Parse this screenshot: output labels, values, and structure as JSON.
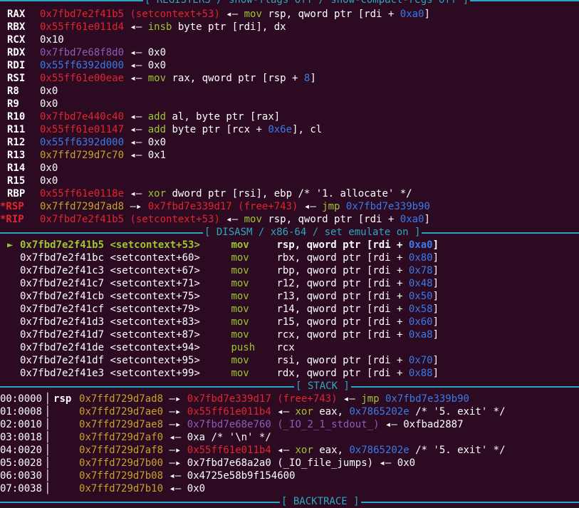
{
  "sections": {
    "registers": "[ REGISTERS / show-flags off / show-compact-regs off ]",
    "disasm": "[ DISASM / x86-64 / set emulate on ]",
    "stack": "[ STACK ]",
    "backtrace": "[ BACKTRACE ]"
  },
  "arrow": "◂—",
  "pointer": "—▸",
  "current": "►",
  "registers": [
    {
      "name": "RAX",
      "val": "0x7fbd7e2f41b5",
      "sym": " (setcontext+53)",
      "rest": [
        [
          "mov",
          "y"
        ],
        [
          " rsp, qword ptr [rdi + ",
          "w"
        ],
        [
          "0xa0",
          "b"
        ],
        [
          "]",
          "w"
        ]
      ]
    },
    {
      "name": "RBX",
      "val": "0x55ff61e011d4",
      "sym": "",
      "rest": [
        [
          "insb",
          "y"
        ],
        [
          " byte ptr [rdi], dx",
          "w"
        ]
      ]
    },
    {
      "name": "RCX",
      "val": "0x10",
      "plain": true
    },
    {
      "name": "RDX",
      "val": "0x7fbd7e68f8d0",
      "sym": "",
      "rest": [
        [
          "0x0",
          "w"
        ]
      ],
      "color": "p"
    },
    {
      "name": "RDI",
      "val": "0x55ff6392d000",
      "sym": "",
      "rest": [
        [
          "0x0",
          "w"
        ]
      ],
      "color": "b"
    },
    {
      "name": "RSI",
      "val": "0x55ff61e00eae",
      "sym": "",
      "rest": [
        [
          "mov",
          "y"
        ],
        [
          " rax, qword ptr [rsp + ",
          "w"
        ],
        [
          "8",
          "b"
        ],
        [
          "]",
          "w"
        ]
      ]
    },
    {
      "name": "R8",
      "val": "0x0",
      "plain": true
    },
    {
      "name": "R9",
      "val": "0x0",
      "plain": true
    },
    {
      "name": "R10",
      "val": "0x7fbd7e440c40",
      "sym": "",
      "rest": [
        [
          "add",
          "y"
        ],
        [
          " al, byte ptr [rax]",
          "w"
        ]
      ]
    },
    {
      "name": "R11",
      "val": "0x55ff61e01147",
      "sym": "",
      "rest": [
        [
          "add",
          "y"
        ],
        [
          " byte ptr [rcx + ",
          "w"
        ],
        [
          "0x6e",
          "b"
        ],
        [
          "], cl",
          "w"
        ]
      ]
    },
    {
      "name": "R12",
      "val": "0x55ff6392d000",
      "sym": "",
      "rest": [
        [
          "0x0",
          "w"
        ]
      ],
      "color": "b"
    },
    {
      "name": "R13",
      "val": "0x7ffd729d7c70",
      "sym": "",
      "rest": [
        [
          "0x1",
          "w"
        ]
      ],
      "color": "ye"
    },
    {
      "name": "R14",
      "val": "0x0",
      "plain": true
    },
    {
      "name": "R15",
      "val": "0x0",
      "plain": true
    },
    {
      "name": "RBP",
      "val": "0x55ff61e0118e",
      "sym": "",
      "rest": [
        [
          "xor",
          "y"
        ],
        [
          " dword ptr [rsi], ebp /* '1. allocate' */",
          "w"
        ]
      ]
    },
    {
      "name": "*RSP",
      "val": "0x7ffd729d7ad8",
      "special": "rsp"
    },
    {
      "name": "*RIP",
      "val": "0x7fbd7e2f41b5",
      "sym": " (setcontext+53)",
      "rest": [
        [
          "mov",
          "y"
        ],
        [
          " rsp, qword ptr [rdi + ",
          "w"
        ],
        [
          "0xa0",
          "b"
        ],
        [
          "]",
          "w"
        ]
      ]
    }
  ],
  "rsp_line": {
    "val": "0x7ffd729d7ad8",
    "target": "0x7fbd7e339d17",
    "sym": " (free+743)",
    "op": "jmp",
    "dest": "0x7fbd7e339b90"
  },
  "disasm": [
    {
      "addr": "0x7fbd7e2f41b5",
      "sym": "<setcontext+53>",
      "mnem": "mov",
      "ops": [
        [
          "rsp, qword ptr [rdi + ",
          "w"
        ],
        [
          "0xa0",
          "b"
        ],
        [
          "]",
          "w"
        ]
      ],
      "current": true
    },
    {
      "addr": "0x7fbd7e2f41bc",
      "sym": "<setcontext+60>",
      "mnem": "mov",
      "ops": [
        [
          "rbx, qword ptr [rdi + ",
          "w"
        ],
        [
          "0x80",
          "b"
        ],
        [
          "]",
          "w"
        ]
      ]
    },
    {
      "addr": "0x7fbd7e2f41c3",
      "sym": "<setcontext+67>",
      "mnem": "mov",
      "ops": [
        [
          "rbp, qword ptr [rdi + ",
          "w"
        ],
        [
          "0x78",
          "b"
        ],
        [
          "]",
          "w"
        ]
      ]
    },
    {
      "addr": "0x7fbd7e2f41c7",
      "sym": "<setcontext+71>",
      "mnem": "mov",
      "ops": [
        [
          "r12, qword ptr [rdi + ",
          "w"
        ],
        [
          "0x48",
          "b"
        ],
        [
          "]",
          "w"
        ]
      ]
    },
    {
      "addr": "0x7fbd7e2f41cb",
      "sym": "<setcontext+75>",
      "mnem": "mov",
      "ops": [
        [
          "r13, qword ptr [rdi + ",
          "w"
        ],
        [
          "0x50",
          "b"
        ],
        [
          "]",
          "w"
        ]
      ]
    },
    {
      "addr": "0x7fbd7e2f41cf",
      "sym": "<setcontext+79>",
      "mnem": "mov",
      "ops": [
        [
          "r14, qword ptr [rdi + ",
          "w"
        ],
        [
          "0x58",
          "b"
        ],
        [
          "]",
          "w"
        ]
      ]
    },
    {
      "addr": "0x7fbd7e2f41d3",
      "sym": "<setcontext+83>",
      "mnem": "mov",
      "ops": [
        [
          "r15, qword ptr [rdi + ",
          "w"
        ],
        [
          "0x60",
          "b"
        ],
        [
          "]",
          "w"
        ]
      ]
    },
    {
      "addr": "0x7fbd7e2f41d7",
      "sym": "<setcontext+87>",
      "mnem": "mov",
      "ops": [
        [
          "rcx, qword ptr [rdi + ",
          "w"
        ],
        [
          "0xa8",
          "b"
        ],
        [
          "]",
          "w"
        ]
      ]
    },
    {
      "addr": "0x7fbd7e2f41de",
      "sym": "<setcontext+94>",
      "mnem": "push",
      "ops": [
        [
          "rcx",
          "w"
        ]
      ]
    },
    {
      "addr": "0x7fbd7e2f41df",
      "sym": "<setcontext+95>",
      "mnem": "mov",
      "ops": [
        [
          "rsi, qword ptr [rdi + ",
          "w"
        ],
        [
          "0x70",
          "b"
        ],
        [
          "]",
          "w"
        ]
      ]
    },
    {
      "addr": "0x7fbd7e2f41e3",
      "sym": "<setcontext+99>",
      "mnem": "mov",
      "ops": [
        [
          "rdx, qword ptr [rdi + ",
          "w"
        ],
        [
          "0x88",
          "b"
        ],
        [
          "]",
          "w"
        ]
      ]
    }
  ],
  "stack": [
    {
      "idx": "00:0000",
      "reg": "rsp",
      "addr": "0x7ffd729d7ad8",
      "parts": [
        [
          "—▸ ",
          "w"
        ],
        [
          "0x7fbd7e339d17",
          "r"
        ],
        [
          " (free+743)",
          "r"
        ],
        [
          " ◂— ",
          "w"
        ],
        [
          "jmp",
          "y"
        ],
        [
          " 0x7fbd7e339b90",
          "b"
        ]
      ]
    },
    {
      "idx": "01:0008",
      "reg": "",
      "addr": "0x7ffd729d7ae0",
      "parts": [
        [
          "—▸ ",
          "w"
        ],
        [
          "0x55ff61e011b4",
          "r"
        ],
        [
          " ◂— ",
          "w"
        ],
        [
          "xor",
          "y"
        ],
        [
          " eax, ",
          "w"
        ],
        [
          "0x7865202e",
          "b"
        ],
        [
          " /* '5. exit' */",
          "w"
        ]
      ]
    },
    {
      "idx": "02:0010",
      "reg": "",
      "addr": "0x7ffd729d7ae8",
      "parts": [
        [
          "—▸ ",
          "w"
        ],
        [
          "0x7fbd7e68e760",
          "p"
        ],
        [
          " (_IO_2_1_stdout_)",
          "p"
        ],
        [
          " ◂— ",
          "w"
        ],
        [
          "0xfbad2887",
          "w"
        ]
      ]
    },
    {
      "idx": "03:0018",
      "reg": "",
      "addr": "0x7ffd729d7af0",
      "parts": [
        [
          "◂— ",
          "w"
        ],
        [
          "0xa /* '\\n' */",
          "w"
        ]
      ]
    },
    {
      "idx": "04:0020",
      "reg": "",
      "addr": "0x7ffd729d7af8",
      "parts": [
        [
          "—▸ ",
          "w"
        ],
        [
          "0x55ff61e011b4",
          "r"
        ],
        [
          " ◂— ",
          "w"
        ],
        [
          "xor",
          "y"
        ],
        [
          " eax, ",
          "w"
        ],
        [
          "0x7865202e",
          "b"
        ],
        [
          " /* '5. exit' */",
          "w"
        ]
      ]
    },
    {
      "idx": "05:0028",
      "reg": "",
      "addr": "0x7ffd729d7b00",
      "parts": [
        [
          "—▸ ",
          "w"
        ],
        [
          "0x7fbd7e68a2a0 (_IO_file_jumps)",
          "w"
        ],
        [
          " ◂— ",
          "w"
        ],
        [
          "0x0",
          "w"
        ]
      ]
    },
    {
      "idx": "06:0030",
      "reg": "",
      "addr": "0x7ffd729d7b08",
      "parts": [
        [
          "◂— ",
          "w"
        ],
        [
          "0x4725e58b9f154600",
          "w"
        ]
      ]
    },
    {
      "idx": "07:0038",
      "reg": "",
      "addr": "0x7ffd729d7b10",
      "parts": [
        [
          "◂— ",
          "w"
        ],
        [
          "0x0",
          "w"
        ]
      ]
    }
  ]
}
